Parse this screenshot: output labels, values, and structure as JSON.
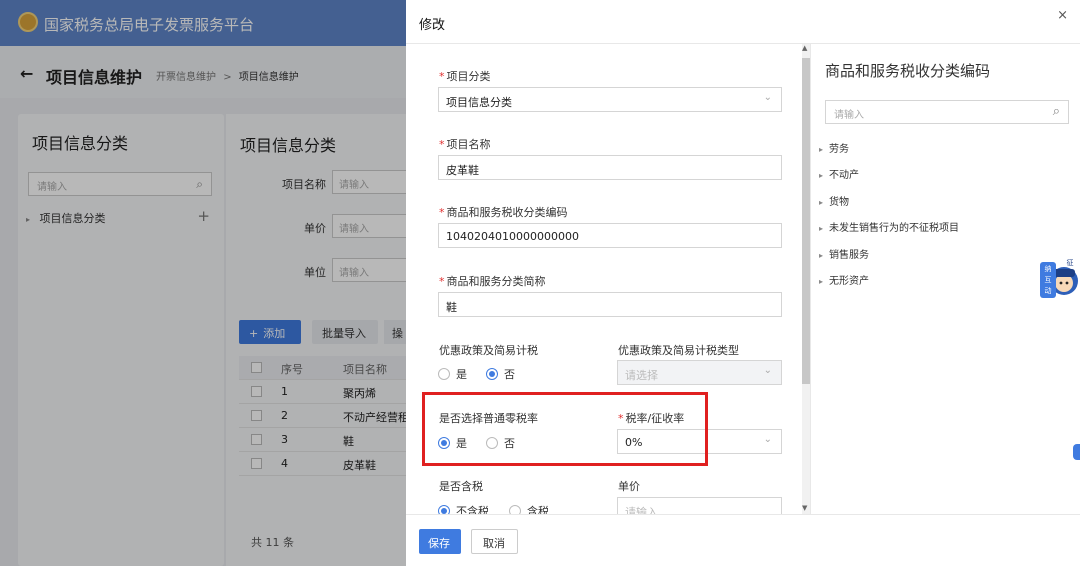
{
  "app": {
    "title": "国家税务总局电子发票服务平台"
  },
  "header": {
    "back_icon": "←",
    "page_title": "项目信息维护",
    "breadcrumb": [
      "开票信息维护",
      "项目信息维护"
    ],
    "breadcrumb_sep": ">"
  },
  "left_panel": {
    "title": "项目信息分类",
    "search_placeholder": "请输入",
    "tree": [
      {
        "label": "项目信息分类"
      }
    ]
  },
  "main_panel": {
    "title": "项目信息分类",
    "filters": [
      {
        "label": "项目名称",
        "placeholder": "请输入"
      },
      {
        "label": "单价",
        "placeholder": "请输入"
      },
      {
        "label": "单位",
        "placeholder": "请输入"
      }
    ],
    "buttons": {
      "add": "添加",
      "add_icon": "+",
      "import": "批量导入",
      "more": "操"
    },
    "table": {
      "columns": [
        "序号",
        "项目名称"
      ],
      "rows": [
        {
          "no": "1",
          "name": "聚丙烯"
        },
        {
          "no": "2",
          "name": "不动产经营租"
        },
        {
          "no": "3",
          "name": "鞋"
        },
        {
          "no": "4",
          "name": "皮革鞋"
        }
      ]
    },
    "total": "共 11 条"
  },
  "dialog": {
    "title": "修改",
    "close": "×",
    "fields": {
      "category": {
        "label": "项目分类",
        "value": "项目信息分类"
      },
      "name": {
        "label": "项目名称",
        "value": "皮革鞋"
      },
      "tax_code": {
        "label": "商品和服务税收分类编码",
        "value": "1040204010000000000"
      },
      "tax_short": {
        "label": "商品和服务分类简称",
        "value": "鞋"
      },
      "preferential": {
        "label": "优惠政策及简易计税",
        "options": [
          "是",
          "否"
        ],
        "selected": "否"
      },
      "preferential_type": {
        "label": "优惠政策及简易计税类型",
        "placeholder": "请选择"
      },
      "zero_rate": {
        "label": "是否选择普通零税率",
        "options": [
          "是",
          "否"
        ],
        "selected": "是"
      },
      "tax_rate": {
        "label": "税率/征收率",
        "value": "0%"
      },
      "tax_included": {
        "label": "是否含税",
        "options": [
          "不含税",
          "含税"
        ],
        "selected": "不含税"
      },
      "unit_price": {
        "label": "单价",
        "placeholder": "请输入"
      }
    },
    "required_mark": "*",
    "code_panel": {
      "title": "商品和服务税收分类编码",
      "search_placeholder": "请输入",
      "items": [
        "劳务",
        "不动产",
        "货物",
        "未发生销售行为的不征税项目",
        "销售服务",
        "无形资产"
      ]
    },
    "mascot_text": [
      "征",
      "纳",
      "互",
      "动"
    ],
    "footer": {
      "save": "保存",
      "cancel": "取消"
    }
  },
  "colors": {
    "primary": "#3f7be0",
    "topbar": "#5f86c9",
    "highlight": "#e02020",
    "required": "#e03030"
  }
}
